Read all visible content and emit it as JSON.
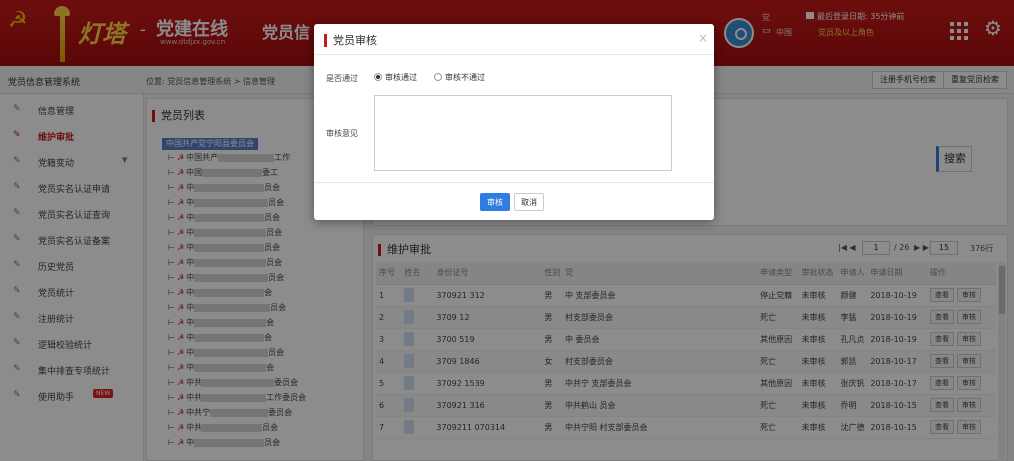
{
  "header": {
    "logo_text": "灯塔",
    "logo_dash": "-",
    "site_name": "党建在线",
    "site_url": "www.dtdjzx.gov.cn",
    "app_title": "党员信",
    "user_name": "党",
    "user_org": "中国",
    "last_login": "最后登录日期: 35分钟前",
    "user_role": "党员及以上角色",
    "brand_color": "#c81a1a",
    "icons": [
      "party-emblem-icon",
      "lighthouse-icon",
      "avatar",
      "monitor-icon",
      "calendar-icon",
      "grid-icon",
      "gear-icon"
    ]
  },
  "topbar": {
    "system_name": "党员信息管理系统",
    "breadcrumb": "位置: 党员信息管理系统 > 信息管理",
    "btn_register_phone": "注册手机号检索",
    "btn_duplicate": "重复党员检索"
  },
  "sidebar": {
    "items": [
      {
        "label": "信息管理"
      },
      {
        "label": "维护审批",
        "active": true
      },
      {
        "label": "党籍变动",
        "has_caret": true
      },
      {
        "label": "党员实名认证申请"
      },
      {
        "label": "党员实名认证查询"
      },
      {
        "label": "党员实名认证备案"
      },
      {
        "label": "历史党员"
      },
      {
        "label": "党员统计"
      },
      {
        "label": "注册统计"
      },
      {
        "label": "逻辑校验统计"
      },
      {
        "label": "集中排查专项统计"
      },
      {
        "label": "使用助手",
        "badge": "NEW"
      }
    ]
  },
  "member_list": {
    "title": "党员列表",
    "root": "中国共产党宁阳县委员会",
    "rows": [
      {
        "prefix": "中国共产",
        "suffix": "工作"
      },
      {
        "prefix": "中国",
        "suffix": "委工"
      },
      {
        "prefix": "中",
        "suffix": "员会"
      },
      {
        "prefix": "中",
        "suffix": "员会"
      },
      {
        "prefix": "中",
        "suffix": "员会"
      },
      {
        "prefix": "中",
        "suffix": "员会"
      },
      {
        "prefix": "中",
        "suffix": "员会"
      },
      {
        "prefix": "中",
        "suffix": "员会"
      },
      {
        "prefix": "中",
        "suffix": "员会"
      },
      {
        "prefix": "中",
        "suffix": "会"
      },
      {
        "prefix": "中",
        "suffix": "员会"
      },
      {
        "prefix": "中",
        "suffix": "会"
      },
      {
        "prefix": "中",
        "suffix": "会"
      },
      {
        "prefix": "中",
        "suffix": "员会"
      },
      {
        "prefix": "中",
        "suffix": "会"
      },
      {
        "prefix": "中共",
        "suffix": "委员会"
      },
      {
        "prefix": "中共",
        "suffix": "工作委员会"
      },
      {
        "prefix": "中共宁",
        "suffix": "委员会"
      },
      {
        "prefix": "中共",
        "suffix": "员会"
      },
      {
        "prefix": "中",
        "suffix": "员会"
      }
    ]
  },
  "search": {
    "button": "搜索"
  },
  "approval": {
    "title": "维护审批",
    "pager": {
      "first": "|◀ ◀",
      "page": "1",
      "of": "/ 26",
      "next": "▶ ▶|",
      "page_size": "15",
      "total": "376行"
    },
    "columns": [
      "序号",
      "姓名",
      "身份证号",
      "性别",
      "党",
      "申请类型",
      "审批状态",
      "申请人",
      "申请日期",
      "操作"
    ],
    "rows": [
      {
        "no": "1",
        "id": "370921  312",
        "sex": "男",
        "org": "中  支部委员会",
        "type": "停止党籍",
        "status": "未审核",
        "applicant": "颜健",
        "date": "2018-10-19"
      },
      {
        "no": "2",
        "id": "3709  12",
        "sex": "男",
        "org": "  村支部委员会",
        "type": "死亡",
        "status": "未审核",
        "applicant": "李猛",
        "date": "2018-10-19"
      },
      {
        "no": "3",
        "id": "3700  519",
        "sex": "男",
        "org": "中  委员会",
        "type": "其他原因",
        "status": "未审核",
        "applicant": "孔凡贞",
        "date": "2018-10-19"
      },
      {
        "no": "4",
        "id": "3709  1846",
        "sex": "女",
        "org": "  村支部委员会",
        "type": "死亡",
        "status": "未审核",
        "applicant": "郭凯",
        "date": "2018-10-17"
      },
      {
        "no": "5",
        "id": "37092  1539",
        "sex": "男",
        "org": "中共宁  支部委员会",
        "type": "其他原因",
        "status": "未审核",
        "applicant": "张庆钒",
        "date": "2018-10-17"
      },
      {
        "no": "6",
        "id": "370921  316",
        "sex": "男",
        "org": "中共鹤山  员会",
        "type": "死亡",
        "status": "未审核",
        "applicant": "乔明",
        "date": "2018-10-15"
      },
      {
        "no": "7",
        "id": "3709211  070314",
        "sex": "男",
        "org": "中共宁阳  村支部委员会",
        "type": "死亡",
        "status": "未审核",
        "applicant": "沈广德",
        "date": "2018-10-15"
      }
    ],
    "op_view": "查看",
    "op_approve": "审核"
  },
  "modal": {
    "title": "党员审核",
    "close": "×",
    "pass_label": "是否通过",
    "opt_pass": "审核通过",
    "opt_reject": "审核不通过",
    "selected": "审核通过",
    "comment_label": "审核意见",
    "comment_value": "",
    "btn_approve": "审核",
    "btn_cancel": "取消"
  }
}
